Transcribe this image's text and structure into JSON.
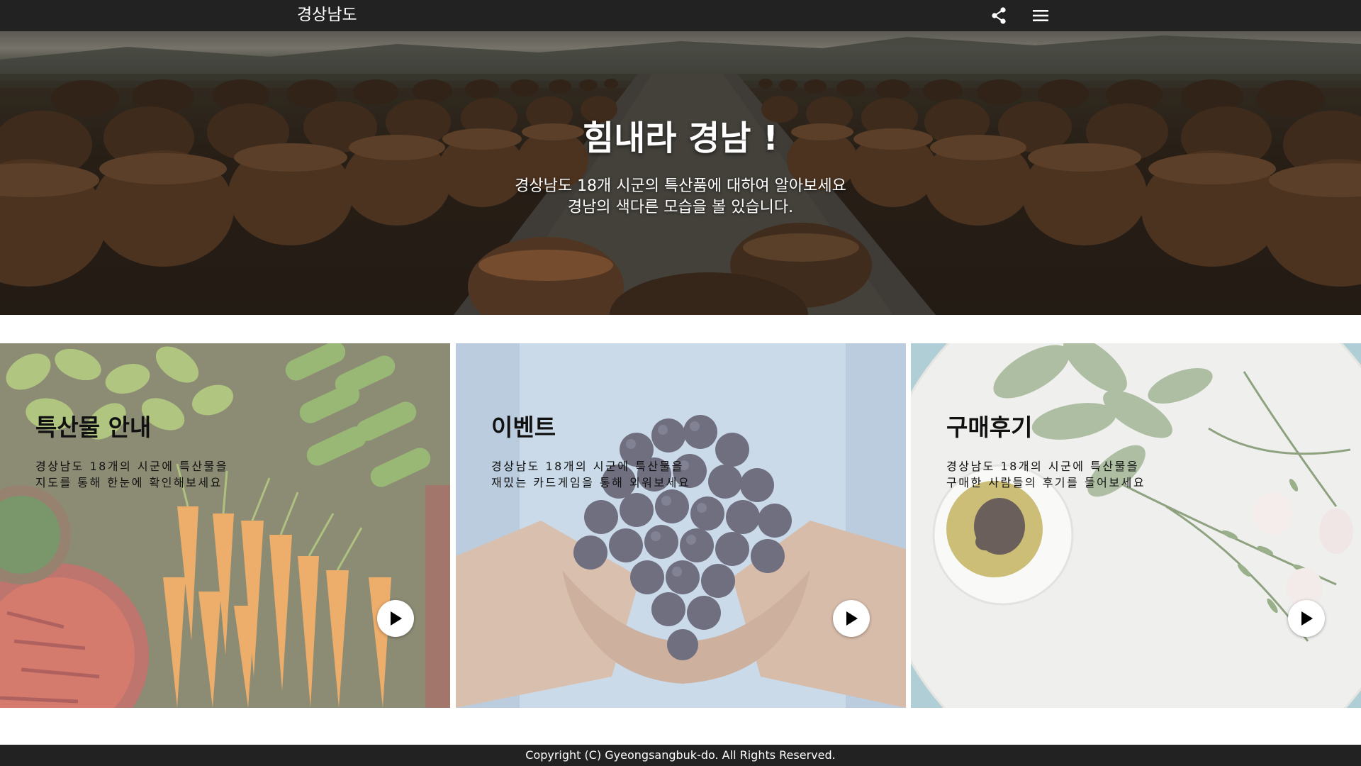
{
  "header": {
    "title": "경상남도",
    "share_icon": "share-icon",
    "menu_icon": "hamburger-menu-icon"
  },
  "hero": {
    "title": "힘내라 경남 !",
    "subtitle_line1": "경상남도 18개 시군의 특산품에 대하여 알아보세요",
    "subtitle_line2": "경남의 색다른 모습을 볼 있습니다.",
    "image": "onggi-jars-field-photo"
  },
  "cards": [
    {
      "title": "특산물 안내",
      "desc_line1": "경상남도 18개의 시군에 특산물을",
      "desc_line2": "지도를 통해 한눈에 확인해보세요",
      "image": "vegetables-photo",
      "action_icon": "play-icon"
    },
    {
      "title": "이벤트",
      "desc_line1": "경상남도 18개의 시군에 특산물을",
      "desc_line2": "재밌는 카드게임을 통해 외워보세요",
      "image": "grapes-in-hands-photo",
      "action_icon": "play-icon"
    },
    {
      "title": "구매후기",
      "desc_line1": "경상남도 18개의 시군에 특산물을",
      "desc_line2": "구매한 사람들의 후기를 들어보세요",
      "image": "herbs-and-oil-photo",
      "action_icon": "play-icon"
    }
  ],
  "footer": {
    "copyright": "Copyright (C) Gyeongsangbuk-do. All Rights Reserved."
  },
  "colors": {
    "bar_background": "#222222",
    "text_light": "#ffffff",
    "text_dark": "#111111"
  }
}
